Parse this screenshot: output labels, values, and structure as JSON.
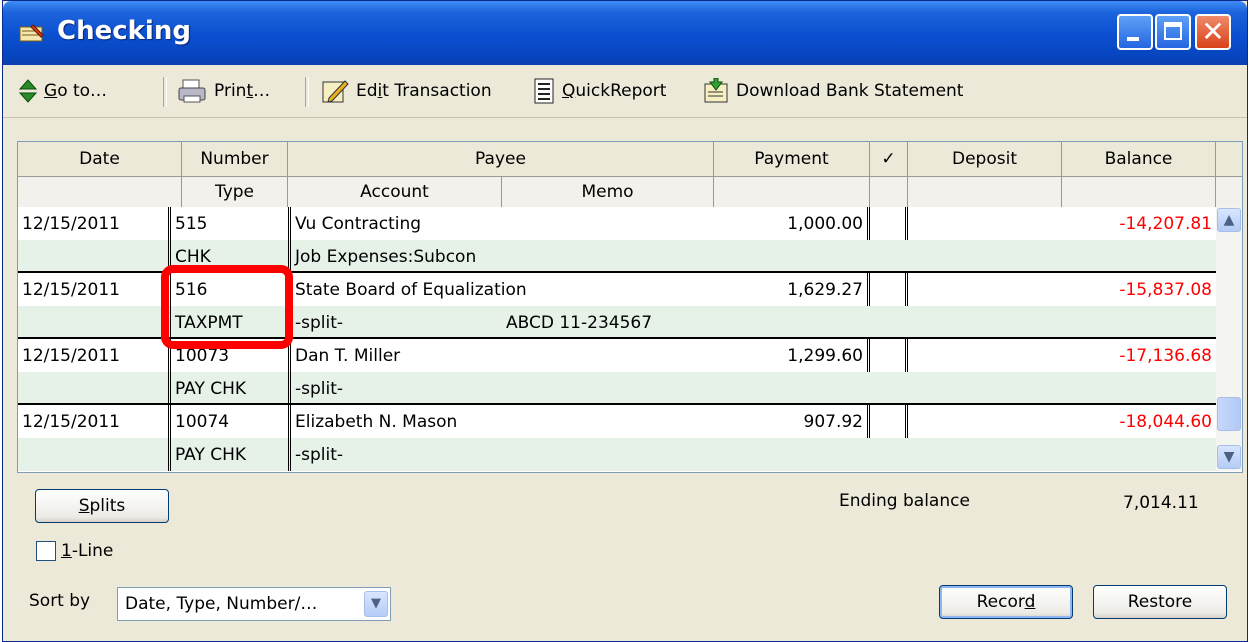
{
  "window": {
    "title": "Checking"
  },
  "toolbar": {
    "goto_prefix": "G",
    "goto_rest": "o to…",
    "print_prefix": "Prin",
    "print_u": "t",
    "print_rest": "…",
    "edit_prefix": "Ed",
    "edit_u": "i",
    "edit_rest": "t Transaction",
    "quick_u": "Q",
    "quick_rest": "uickReport",
    "download_label": "Download Bank Statement"
  },
  "columns": {
    "row1": [
      "Date",
      "Number",
      "Payee",
      "Payment",
      "✓",
      "Deposit",
      "Balance"
    ],
    "row2": [
      "Type",
      "Account",
      "Memo"
    ]
  },
  "transactions": [
    {
      "date": "12/15/2011",
      "number": "515",
      "payee": "Vu Contracting",
      "payment": "1,000.00",
      "balance": "-14,207.81",
      "type": "CHK",
      "account": "Job Expenses:Subcon",
      "memo": ""
    },
    {
      "date": "12/15/2011",
      "number": "516",
      "payee": "State Board of Equalization",
      "payment": "1,629.27",
      "balance": "-15,837.08",
      "type": "TAXPMT",
      "account": "-split-",
      "memo": "ABCD 11-234567"
    },
    {
      "date": "12/15/2011",
      "number": "10073",
      "payee": "Dan T. Miller",
      "payment": "1,299.60",
      "balance": "-17,136.68",
      "type": "PAY CHK",
      "account": "-split-",
      "memo": ""
    },
    {
      "date": "12/15/2011",
      "number": "10074",
      "payee": "Elizabeth N. Mason",
      "payment": "907.92",
      "balance": "-18,044.60",
      "type": "PAY CHK",
      "account": "-split-",
      "memo": ""
    }
  ],
  "footer": {
    "splits_u": "S",
    "splits_rest": "plits",
    "ending_balance_label": "Ending balance",
    "ending_balance_value": "7,014.11",
    "one_line_u": "1",
    "one_line_rest": "-Line",
    "sort_by_label": "Sort by",
    "sort_value": "Date, Type, Number/…",
    "record_prefix": "Recor",
    "record_u": "d",
    "restore_label": "Restore"
  },
  "colors": {
    "negative": "#ff0000",
    "row_tint": "#e6f1e8",
    "title_blue": "#0a4fd0",
    "highlight": "#ff0000"
  }
}
